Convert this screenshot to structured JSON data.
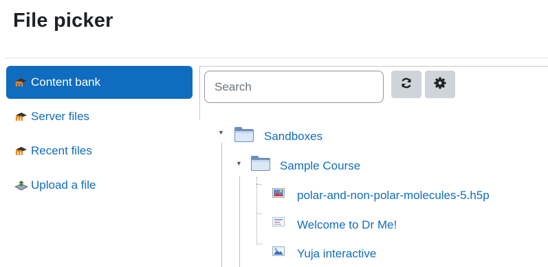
{
  "page": {
    "title": "File picker"
  },
  "sidebar": {
    "items": [
      {
        "label": "Content bank",
        "icon": "moodle-icon",
        "active": true
      },
      {
        "label": "Server files",
        "icon": "moodle-icon",
        "active": false
      },
      {
        "label": "Recent files",
        "icon": "moodle-icon",
        "active": false
      },
      {
        "label": "Upload a file",
        "icon": "upload-icon",
        "active": false
      }
    ]
  },
  "toolbar": {
    "search_placeholder": "Search",
    "refresh_icon": "refresh-icon",
    "settings_icon": "gear-icon"
  },
  "tree": {
    "root": {
      "label": "Sandboxes",
      "icon": "folder-icon",
      "expanded": true
    },
    "course": {
      "label": "Sample Course",
      "icon": "folder-icon",
      "expanded": true
    },
    "files": [
      {
        "label": "polar-and-non-polar-molecules-5.h5p",
        "icon": "image-file-icon"
      },
      {
        "label": "Welcome to Dr Me!",
        "icon": "presentation-file-icon"
      },
      {
        "label": "Yuja interactive",
        "icon": "interactive-file-icon"
      }
    ]
  },
  "colors": {
    "accent": "#0f6cbf",
    "button_bg": "#ced4da",
    "text": "#1d2125"
  }
}
